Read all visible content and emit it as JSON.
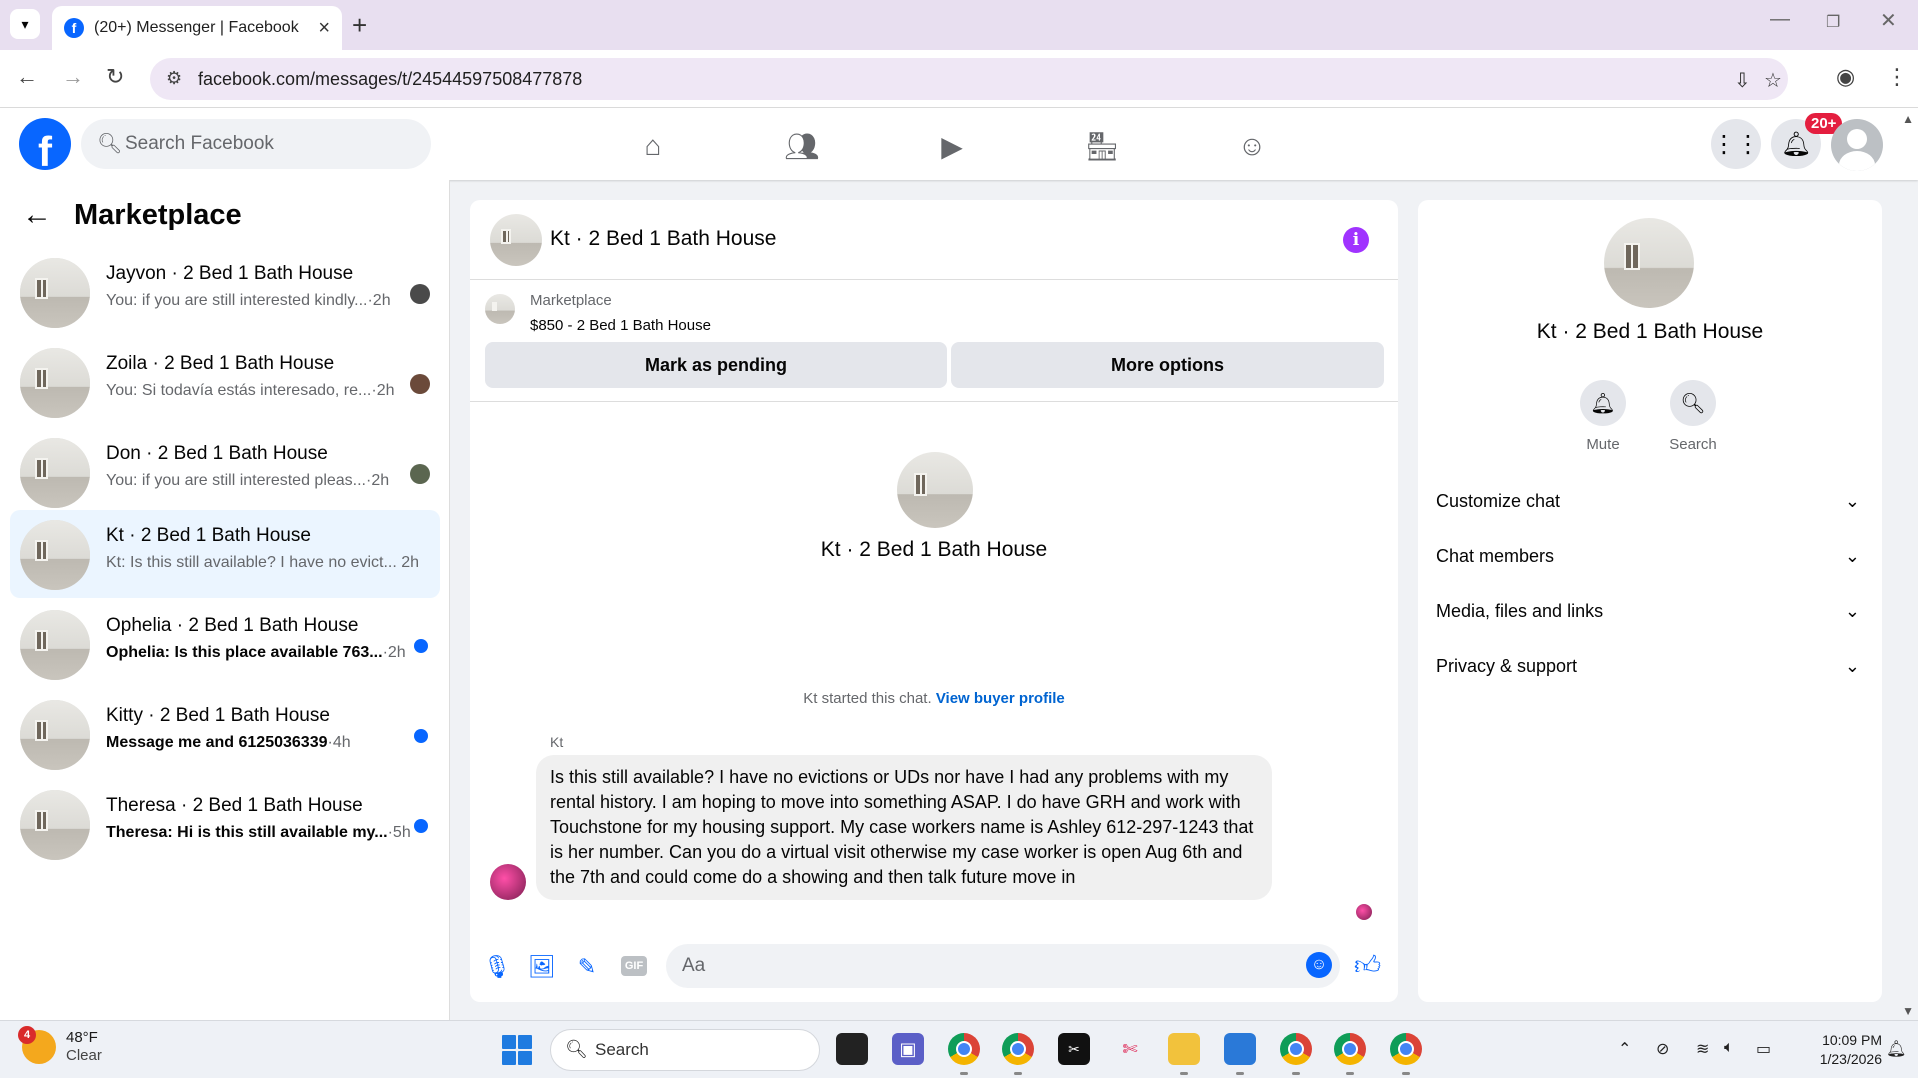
{
  "browser": {
    "tab_title": "(20+) Messenger | Facebook",
    "url": "facebook.com/messages/t/24544597508477878"
  },
  "fb": {
    "search_placeholder": "Search Facebook",
    "notif_count": "20+",
    "brand_color": "#0866ff"
  },
  "sidebar": {
    "title": "Marketplace",
    "conversations": [
      {
        "name": "Jayvon · 2 Bed 1 Bath House",
        "snippet": "You: if you are still interested kindly...",
        "time": "·2h",
        "unread": false
      },
      {
        "name": "Zoila · 2 Bed 1 Bath House",
        "snippet": "You: Si todavía estás interesado, re...",
        "time": "·2h",
        "unread": false
      },
      {
        "name": "Don · 2 Bed 1 Bath House",
        "snippet": "You: if you are still interested pleas...",
        "time": "·2h",
        "unread": false
      },
      {
        "name": "Kt · 2 Bed 1 Bath House",
        "snippet": "Kt: Is this still available? I have no evict...",
        "time": " 2h",
        "unread": false,
        "active": true
      },
      {
        "name": "Ophelia · 2 Bed 1 Bath House",
        "snippet": "Ophelia: Is this place available 763...",
        "time": "·2h",
        "unread": true
      },
      {
        "name": "Kitty · 2 Bed 1 Bath House",
        "snippet": "Message me and 6125036339",
        "time": "·4h",
        "unread": true
      },
      {
        "name": "Theresa · 2 Bed 1 Bath House",
        "snippet": "Theresa: Hi is this still available my...",
        "time": "·5h",
        "unread": true
      }
    ]
  },
  "chat": {
    "title": "Kt · 2 Bed 1 Bath House",
    "listing_category": "Marketplace",
    "listing_price_title": "$850 - 2 Bed 1 Bath House",
    "mark_pending_label": "Mark as pending",
    "more_options_label": "More options",
    "intro_name": "Kt · 2 Bed 1 Bath House",
    "started_text": "Kt started this chat.",
    "view_buyer_label": "View buyer profile",
    "sender": "Kt",
    "message": "Is this still available? I have no evictions or UDs nor have I had any problems with my rental history. I am hoping to move into something ASAP. I do have GRH and work with Touchstone for my housing support.  My case workers name is Ashley 612-297-1243 that is her number. Can you do a virtual visit otherwise my case worker is open Aug 6th and the 7th and could come do a showing and then talk future move in",
    "input_placeholder": "Aa",
    "gif_label": "GIF"
  },
  "info_panel": {
    "name": "Kt · 2 Bed 1 Bath House",
    "mute_label": "Mute",
    "search_label": "Search",
    "sections": [
      "Customize chat",
      "Chat members",
      "Media, files and links",
      "Privacy & support"
    ]
  },
  "taskbar": {
    "weather_badge": "4",
    "temperature": "48°F",
    "condition": "Clear",
    "search_label": "Search",
    "time": "10:09 PM",
    "date": "1/23/2026"
  }
}
